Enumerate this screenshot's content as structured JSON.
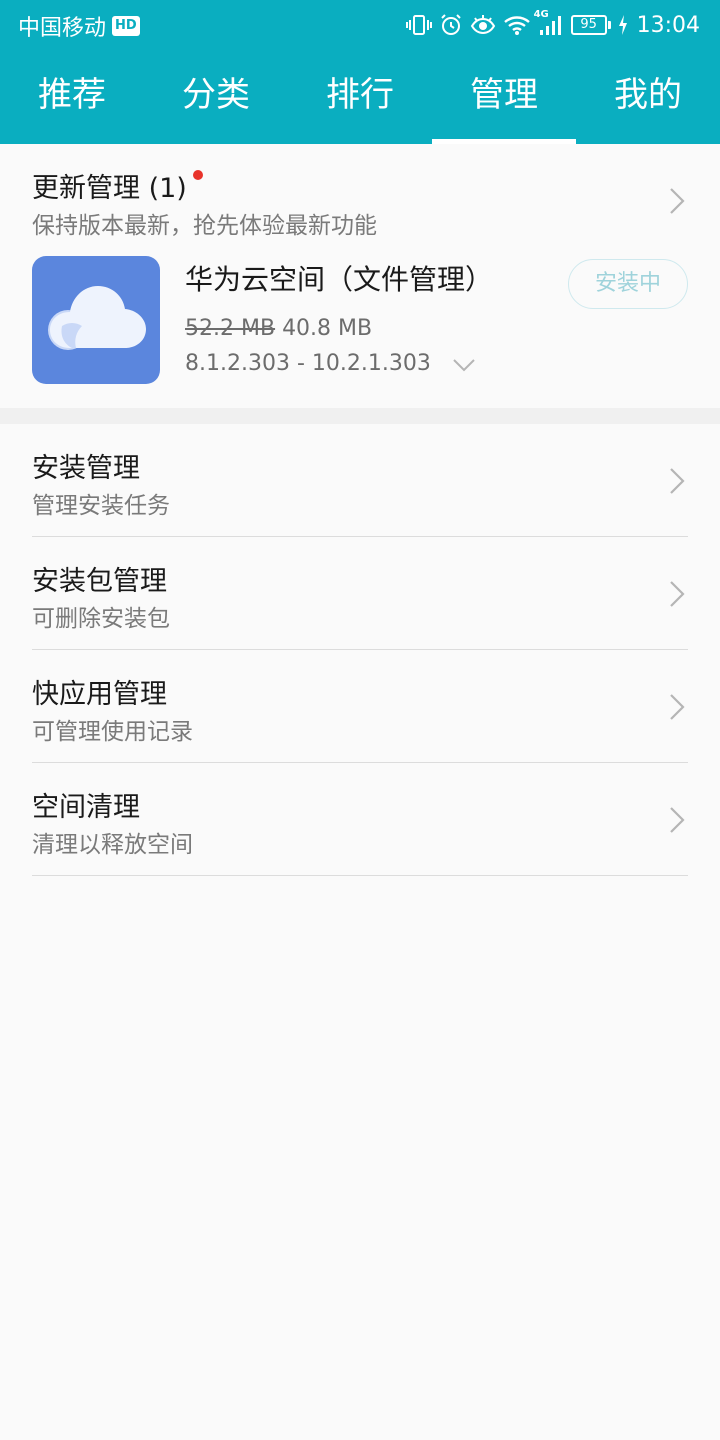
{
  "status_bar": {
    "carrier": "中国移动",
    "hd_badge": "HD",
    "network": "4G",
    "battery": "95",
    "time": "13:04"
  },
  "tabs": [
    {
      "label": "推荐",
      "active": false
    },
    {
      "label": "分类",
      "active": false
    },
    {
      "label": "排行",
      "active": false
    },
    {
      "label": "管理",
      "active": true
    },
    {
      "label": "我的",
      "active": false
    }
  ],
  "update_section": {
    "title": "更新管理",
    "count": "(1)",
    "subtitle": "保持版本最新，抢先体验最新功能",
    "app": {
      "name": "华为云空间（文件管理）",
      "old_size": "52.2 MB",
      "new_size": "40.8 MB",
      "version": "8.1.2.303 - 10.2.1.303",
      "button_label": "安装中",
      "icon": "cloud-icon"
    }
  },
  "menu_items": [
    {
      "title": "安装管理",
      "subtitle": "管理安装任务"
    },
    {
      "title": "安装包管理",
      "subtitle": "可删除安装包"
    },
    {
      "title": "快应用管理",
      "subtitle": "可管理使用记录"
    },
    {
      "title": "空间清理",
      "subtitle": "清理以释放空间"
    }
  ],
  "colors": {
    "accent": "#0aaec0",
    "notification_dot": "#e8332a",
    "app_icon_bg": "#5b86dd"
  }
}
